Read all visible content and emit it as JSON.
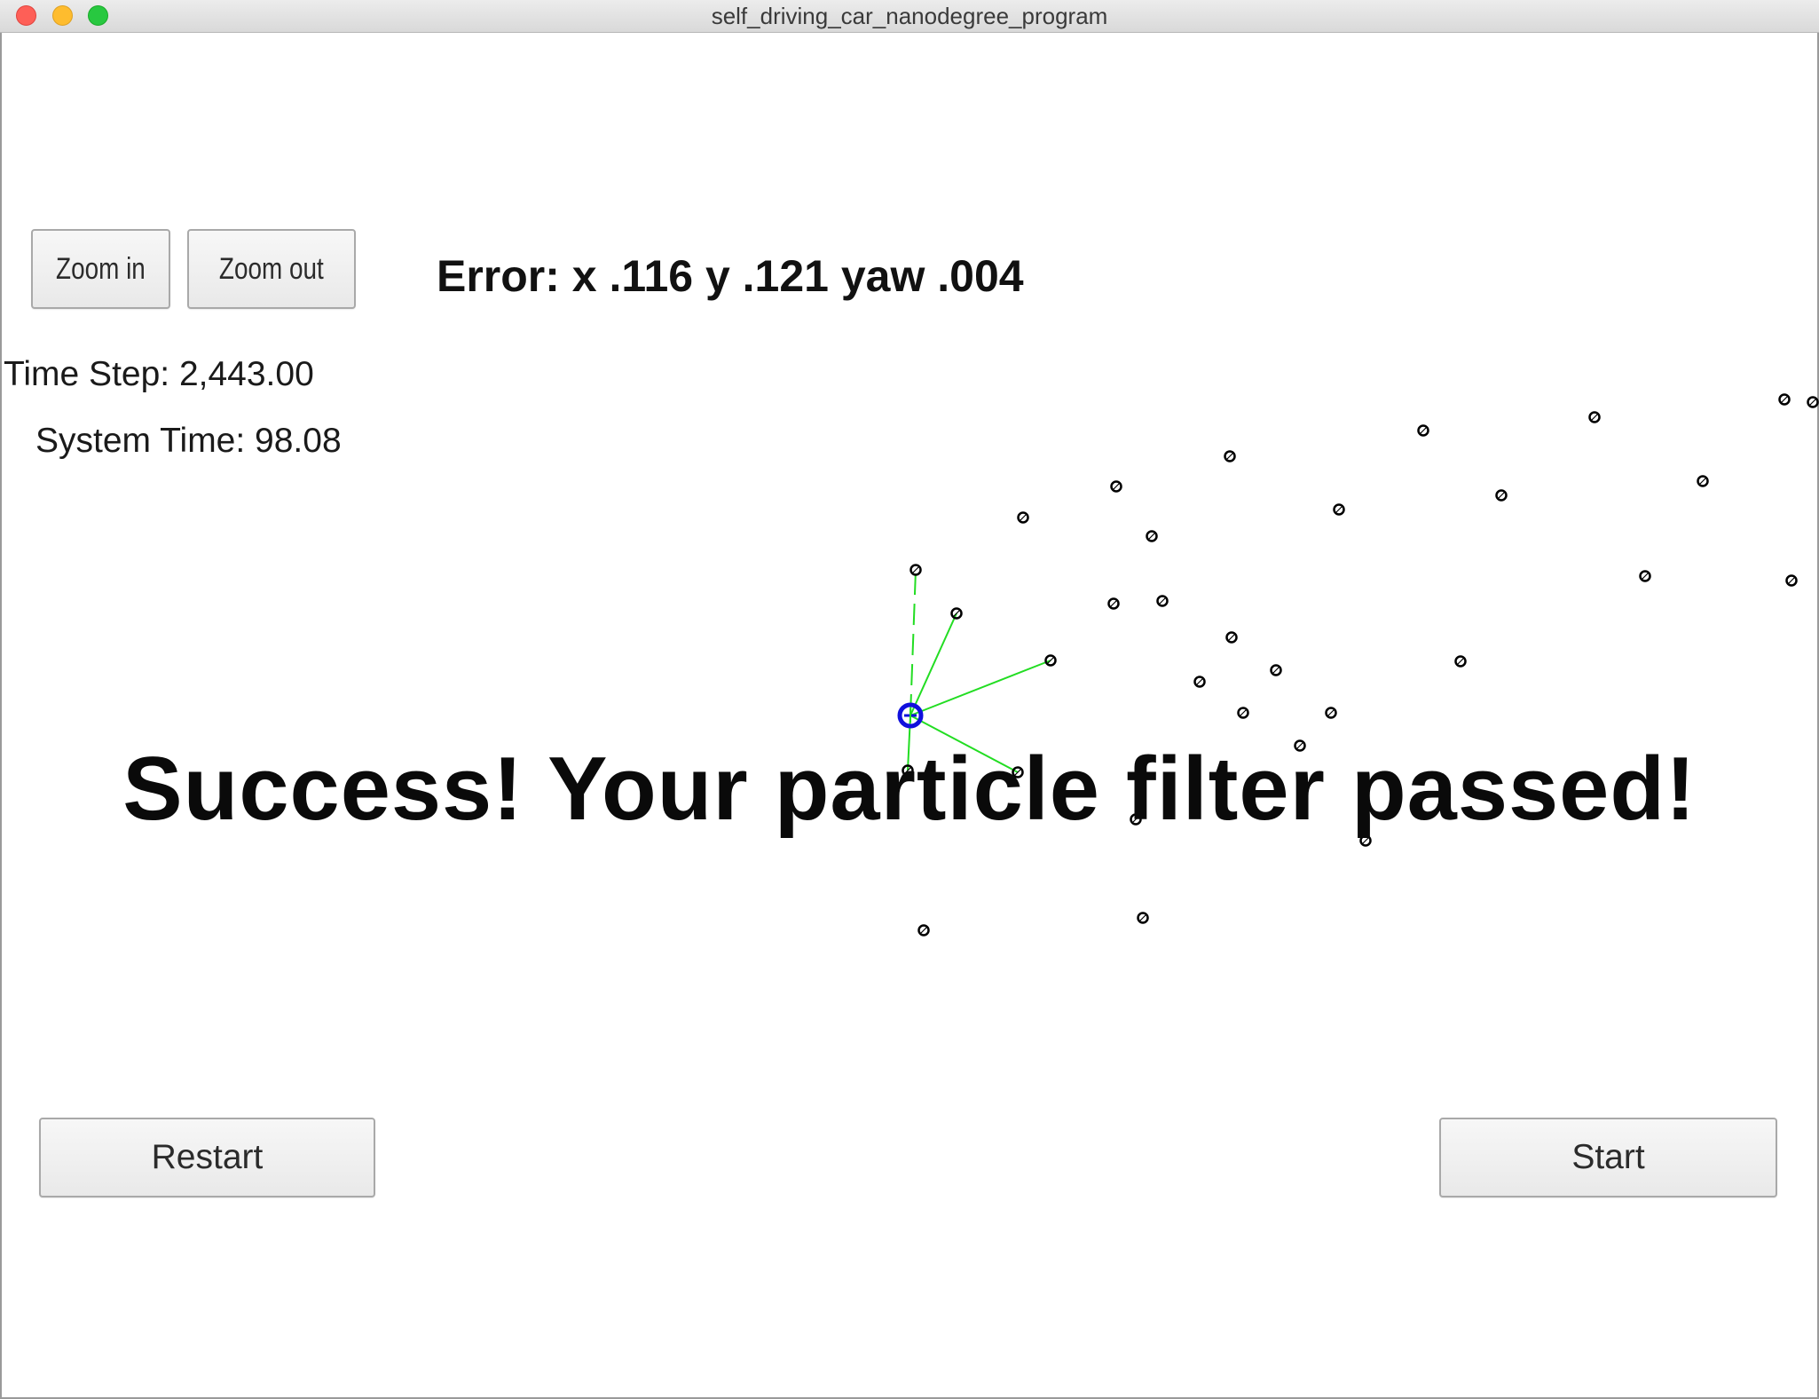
{
  "window": {
    "title": "self_driving_car_nanodegree_program"
  },
  "controls": {
    "zoom_in_label": "Zoom in",
    "zoom_out_label": "Zoom out",
    "restart_label": "Restart",
    "start_label": "Start"
  },
  "status": {
    "error": "Error: x .116 y .121 yaw .004",
    "time_step": "Time Step: 2,443.00",
    "system_time": "System Time: 98.08",
    "success_message": "Success! Your particle filter passed!"
  },
  "colors": {
    "landmark": "#000000",
    "observation_line": "#22dd22",
    "car_marker": "#1010dd"
  }
}
